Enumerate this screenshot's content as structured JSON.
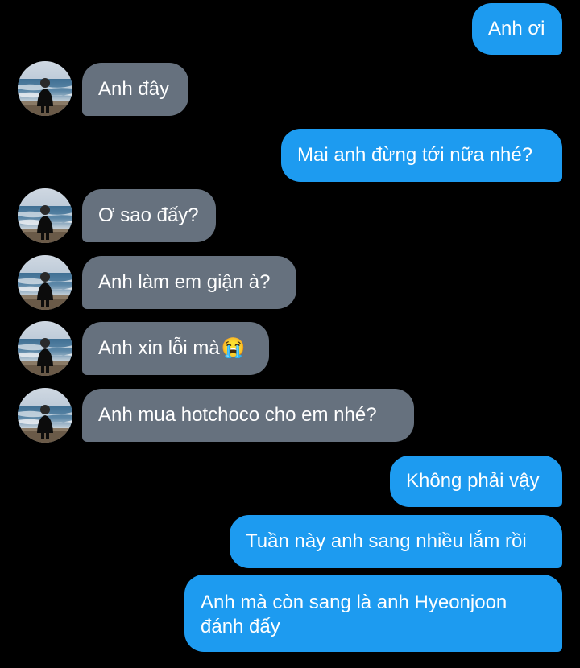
{
  "colors": {
    "background": "#000000",
    "outgoing_bubble": "#1d9bf0",
    "incoming_bubble": "#66717e",
    "text": "#ffffff"
  },
  "messages": [
    {
      "direction": "outgoing",
      "text": "Anh ơi"
    },
    {
      "direction": "incoming",
      "text": "Anh đây",
      "avatar": "beach-person-avatar"
    },
    {
      "direction": "outgoing",
      "text": "Mai anh đừng tới nữa nhé?"
    },
    {
      "direction": "incoming",
      "text": "Ơ sao đấy?",
      "avatar": "beach-person-avatar"
    },
    {
      "direction": "incoming",
      "text": "Anh làm em giận à?",
      "avatar": "beach-person-avatar"
    },
    {
      "direction": "incoming",
      "text": "Anh xin lỗi mà",
      "emoji": "😭",
      "avatar": "beach-person-avatar"
    },
    {
      "direction": "incoming",
      "text": "Anh mua hotchoco cho em nhé?",
      "avatar": "beach-person-avatar"
    },
    {
      "direction": "outgoing",
      "text": "Không phải vậy"
    },
    {
      "direction": "outgoing",
      "text": "Tuần này anh sang nhiều lắm rồi"
    },
    {
      "direction": "outgoing",
      "text": "Anh mà còn sang là anh Hyeonjoon đánh đấy"
    }
  ]
}
